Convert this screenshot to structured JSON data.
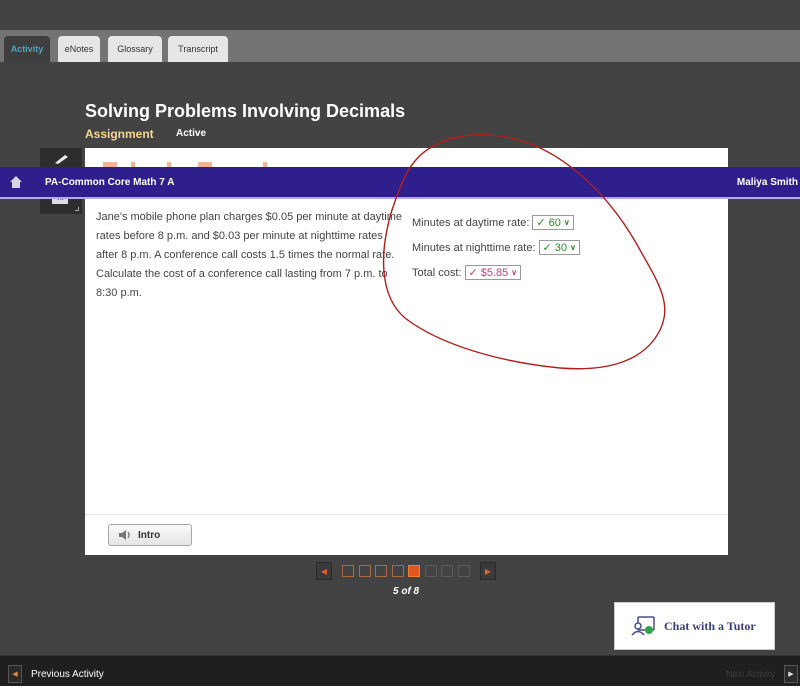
{
  "tabs": [
    {
      "label": "Activity",
      "active": true
    },
    {
      "label": "eNotes",
      "active": false
    },
    {
      "label": "Glossary",
      "active": false
    },
    {
      "label": "Transcript",
      "active": false
    }
  ],
  "lesson": {
    "title": "Solving Problems Involving Decimals",
    "type_label": "Assignment",
    "status": "Active"
  },
  "course_bar": {
    "course_title": "PA-Common Core Math 7 A",
    "user_name": "Maliya Smith",
    "icon": "home-icon"
  },
  "toolbar": {
    "icons": [
      "pencil-icon",
      "formula-icon"
    ],
    "formula_glyph": "√x"
  },
  "problem": {
    "text": "Jane's mobile phone plan charges $0.05 per minute at daytime rates before 8 p.m. and $0.03 per minute at nighttime rates after 8 p.m. A conference call costs 1.5 times the normal rate. Calculate the cost of a conference call lasting from 7 p.m. to 8:30 p.m."
  },
  "answers": [
    {
      "label": "Minutes at daytime rate:",
      "value": "60",
      "mark": "✓",
      "status": "correct",
      "color": "#2a8a2a"
    },
    {
      "label": "Minutes at nighttime rate:",
      "value": "30",
      "mark": "✓",
      "status": "correct",
      "color": "#2a8a2a"
    },
    {
      "label": "Total cost:",
      "value": "$5.85",
      "mark": "✓",
      "status": "marked",
      "color": "#c2417a"
    }
  ],
  "intro_button": {
    "label": "Intro",
    "icon": "speaker-icon"
  },
  "pager": {
    "current": 5,
    "total": 8,
    "label": "5 of 8",
    "accent": "#e2571d"
  },
  "chat": {
    "label": "Chat with a Tutor",
    "icon": "tutor-chat-icon"
  },
  "footer": {
    "previous_label": "Previous Activity",
    "next_label": "Next Activity"
  },
  "annotation": {
    "color": "#b01e1e"
  }
}
